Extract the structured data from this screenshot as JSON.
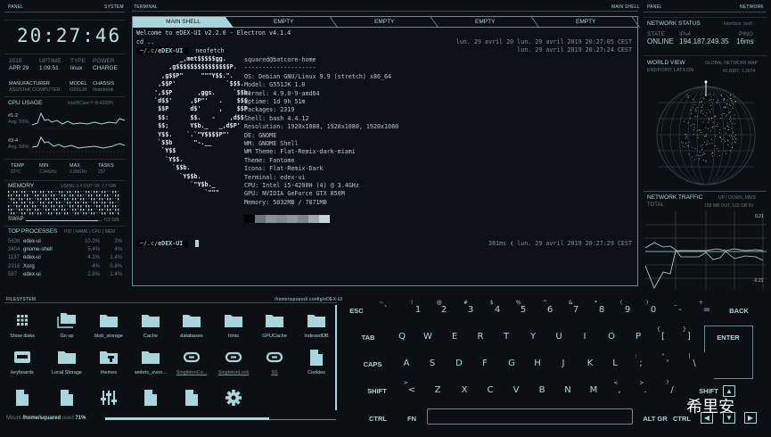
{
  "colors": {
    "accent": "#a9d6da",
    "dim": "#5e7a7e",
    "bg": "#0d1013"
  },
  "left": {
    "panel": "PANEL",
    "section": "SYSTEM",
    "clock": "20:27:46",
    "year": "2019",
    "date": "APR 29",
    "uptime_label": "UPTIME",
    "uptime": "1:09:51",
    "type_label": "TYPE",
    "type": "linux",
    "power_label": "POWER",
    "power": "CHARGE",
    "manufacturer_label": "MANUFACTURER",
    "manufacturer": "ASUSTeK COMPUTER",
    "model_label": "MODEL",
    "model": "G551JK",
    "chassis_label": "CHASSIS",
    "chassis": "Notebook",
    "cpu_title": "CPU USAGE",
    "cpu_name": "Intel®Core™ i5-4200H",
    "cores": [
      {
        "label": "#1-2",
        "avg": "Avg. 55%"
      },
      {
        "label": "#3-4",
        "avg": "Avg. 56%"
      }
    ],
    "stats": [
      {
        "label": "TEMP",
        "value": "82°C"
      },
      {
        "label": "MIN",
        "value": "2.94GHz"
      },
      {
        "label": "MAX",
        "value": "2.99GHz"
      },
      {
        "label": "TASKS",
        "value": "257"
      }
    ],
    "memory_title": "MEMORY",
    "memory_usage": "USING 3.4 OUT OF 7.7 GiB",
    "memory_fraction": 0.44,
    "swap_label": "SWAP",
    "swap_value": "0.2 GiB",
    "swap_fraction": 0.95,
    "proc_title": "TOP PROCESSES",
    "proc_cols": "PID | NAME | CPU | MEM",
    "processes": [
      {
        "pid": "5636",
        "name": "edex-ui",
        "cpu": "10.3%",
        "mem": "2%"
      },
      {
        "pid": "2404",
        "name": "gnome-shell",
        "cpu": "5.4%",
        "mem": "4%"
      },
      {
        "pid": "1137",
        "name": "edex-ui",
        "cpu": "4.1%",
        "mem": "1.4%"
      },
      {
        "pid": "2316",
        "name": "Xorg",
        "cpu": "4%",
        "mem": "0.8%"
      },
      {
        "pid": "587",
        "name": "edex-ui",
        "cpu": "2.8%",
        "mem": "1.4%"
      }
    ]
  },
  "terminal": {
    "panel": "TERMINAL",
    "section": "MAIN SHELL",
    "tabs": [
      "MAIN SHELL",
      "EMPTY",
      "EMPTY",
      "EMPTY",
      "EMPTY"
    ],
    "welcome": "Welcome to eDEX-UI v2.2.0 - Electron v4.1.4",
    "cd": "cd ..",
    "prompt_path": "~/.c/",
    "prompt_dir": "eDEX-UI",
    "command": "neofetch",
    "time1": "lun. 29 avril 20 lun. 29 avril 2019 20:27:05 CEST",
    "time2": "lun. 29 avril 2019 20:27:24 CEST",
    "logo": [
      "            _,met$$$$$gg.",
      "         ,g$$$$$$$$$$$$$$$P.",
      "       ,g$$P\"     \"\"\"Y$$.\".",
      "      ,$$P'              `$$$.",
      "     ',$$P       ,ggs.     `$$b:",
      "     `d$$'     ,$P\"'   .    $$$",
      "      $$P      d$'     ,    $$P",
      "      $$:      $$.   -    ,d$$'",
      "      $$;      Y$b._   _,d$P'",
      "      Y$$.    `.`\"Y$$$$P\"'",
      "      `$$b      \"-.__",
      "       `Y$$",
      "        `Y$$.",
      "          `$$b.",
      "            `Y$$b.",
      "               `\"Y$b._",
      "                   `\"\"\""
    ],
    "info": [
      "squared@batcore-home",
      "--------------------",
      "OS: Debian GNU/Linux 9.9 (stretch) x86_64",
      "Model: G551JK 1.0",
      "Kernel: 4.9.0-9-amd64",
      "Uptime: 1d 9h 51m",
      "Packages: 2319",
      "Shell: bash 4.4.12",
      "Resolution: 1920x1080, 1920x1080, 1920x1080",
      "DE: GNOME",
      "WM: GNOME Shell",
      "WM Theme: Flat-Remix-dark-miami",
      "Theme: Fantome",
      "Icons: Flat-Remix-Dark",
      "Terminal: edex-ui",
      "CPU: Intel i5-4200H (4) @ 3.4GHz",
      "GPU: NVIDIA GeForce GTX 850M",
      "Memory: 5032MB / 7871MB"
    ],
    "swatches": [
      "#000000",
      "#6b7476",
      "#8a9496",
      "#7e8a8c",
      "#8d9799",
      "#7a8688",
      "#a0aaac",
      "#c9d3d4"
    ],
    "last_duration": "381ms",
    "last_time": "lun. 29 avril 2019 20:27:29 CEST"
  },
  "right": {
    "panel": "PANEL",
    "section": "NETWORK",
    "net_title": "NETWORK STATUS",
    "interface": "Interface: tun0",
    "state_label": "STATE",
    "state": "ONLINE",
    "ip_label": "IPv4",
    "ip": "194.187.249.35",
    "ping_label": "PING",
    "ping": "16ms",
    "world_title": "WORLD VIEW",
    "world_sub": "GLOBAL NETWORK MAP",
    "endpoint_label": "ENDPOINT LAT/LON",
    "endpoint": "42.8307, 1.2674",
    "traffic_title": "NETWORK TRAFFIC",
    "traffic_units": "UP / DOWN, MB/S",
    "total_label": "TOTAL",
    "total": "158 MB OUT, 132 GB IN",
    "axis_max": "0.21",
    "axis_min": "-0.21"
  },
  "filesystem": {
    "panel": "FILESYSTEM",
    "path": "/home/squared/.config/eDEX-UI",
    "items": [
      {
        "label": "Show disks",
        "icon": "grid"
      },
      {
        "label": "Go up",
        "icon": "folders"
      },
      {
        "label": "blob_storage",
        "icon": "folder"
      },
      {
        "label": "Cache",
        "icon": "folder"
      },
      {
        "label": "databases",
        "icon": "folder"
      },
      {
        "label": "fonts",
        "icon": "folder"
      },
      {
        "label": "GPUCache",
        "icon": "folder"
      },
      {
        "label": "IndexedDB",
        "icon": "folder"
      },
      {
        "label": "keyboards",
        "icon": "keyboard"
      },
      {
        "label": "Local Storage",
        "icon": "folder"
      },
      {
        "label": "themes",
        "icon": "theme"
      },
      {
        "label": "webrtc_even...",
        "icon": "folder"
      },
      {
        "label": "SingletonCo...",
        "icon": "link"
      },
      {
        "label": "SingletonLock",
        "icon": "link"
      },
      {
        "label": "SS",
        "icon": "link"
      },
      {
        "label": "Cookies",
        "icon": "file"
      },
      {
        "label": "",
        "icon": "file"
      },
      {
        "label": "",
        "icon": "file"
      },
      {
        "label": "",
        "icon": "sliders"
      },
      {
        "label": "",
        "icon": "file"
      },
      {
        "label": "",
        "icon": "file"
      },
      {
        "label": "",
        "icon": "gear"
      }
    ],
    "mount_prefix": "Mount ",
    "mount_path": "/home/squared",
    "mount_used": " used ",
    "mount_pct": "71%",
    "mount_fraction": 0.71
  },
  "keyboard": {
    "rows": [
      [
        [
          "ESC",
          ""
        ],
        [
          "`",
          "~"
        ],
        [
          "1",
          "!"
        ],
        [
          "2",
          "@"
        ],
        [
          "3",
          "#"
        ],
        [
          "4",
          "$"
        ],
        [
          "5",
          "%"
        ],
        [
          "6",
          "^"
        ],
        [
          "7",
          "&"
        ],
        [
          "8",
          "*"
        ],
        [
          "9",
          "("
        ],
        [
          "0",
          ")"
        ],
        [
          "-",
          "_"
        ],
        [
          "=",
          "+"
        ],
        [
          "BACK",
          ""
        ]
      ],
      [
        [
          "TAB",
          ""
        ],
        [
          "Q",
          ""
        ],
        [
          "W",
          ""
        ],
        [
          "E",
          ""
        ],
        [
          "R",
          ""
        ],
        [
          "T",
          ""
        ],
        [
          "Y",
          ""
        ],
        [
          "U",
          ""
        ],
        [
          "I",
          ""
        ],
        [
          "O",
          ""
        ],
        [
          "P",
          ""
        ],
        [
          "[",
          "{"
        ],
        [
          "]",
          "}"
        ],
        [
          "ENTER",
          ""
        ]
      ],
      [
        [
          "CAPS",
          ""
        ],
        [
          "A",
          ""
        ],
        [
          "S",
          ""
        ],
        [
          "D",
          ""
        ],
        [
          "F",
          ""
        ],
        [
          "G",
          ""
        ],
        [
          "H",
          ""
        ],
        [
          "J",
          ""
        ],
        [
          "K",
          ""
        ],
        [
          "L",
          ""
        ],
        [
          ";",
          ":"
        ],
        [
          "'",
          "\""
        ],
        [
          "\\",
          "|"
        ]
      ],
      [
        [
          "SHIFT",
          ""
        ],
        [
          "<",
          ">"
        ],
        [
          "Z",
          ""
        ],
        [
          "X",
          ""
        ],
        [
          "C",
          ""
        ],
        [
          "V",
          ""
        ],
        [
          "B",
          ""
        ],
        [
          "N",
          ""
        ],
        [
          "M",
          ""
        ],
        [
          ",",
          "<"
        ],
        [
          ".",
          ">"
        ],
        [
          "/",
          "?"
        ],
        [
          "SHIFT",
          ""
        ]
      ],
      [
        [
          "CTRL",
          ""
        ],
        [
          "FN",
          ""
        ],
        [
          "ALT GR",
          ""
        ],
        [
          "CTRL",
          ""
        ]
      ]
    ],
    "arrows": {
      "up": "▲",
      "left": "◀",
      "down": "▼",
      "right": "▶"
    }
  },
  "watermark": "希里安"
}
